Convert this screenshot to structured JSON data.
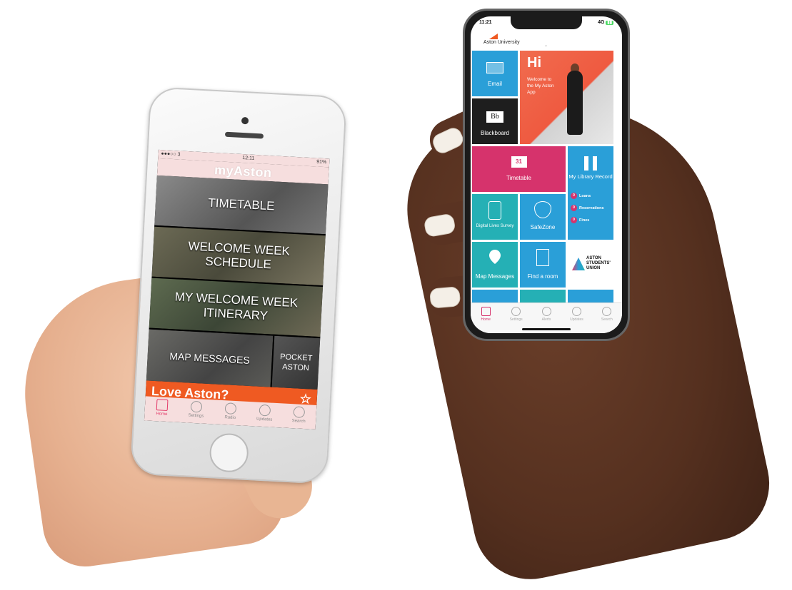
{
  "left_phone": {
    "status": {
      "carrier": "●●●○○ 3",
      "time": "12:11",
      "battery": "91%"
    },
    "header_title": "myAston",
    "tiles": {
      "timetable": "TIMETABLE",
      "welcome_week": "WELCOME WEEK SCHEDULE",
      "itinerary": "MY WELCOME WEEK ITINERARY",
      "map_messages": "MAP MESSAGES",
      "pocket_aston": "POCKET ASTON"
    },
    "banner": {
      "text": "Love Aston?",
      "icon": "star-icon"
    },
    "tabs": [
      "Home",
      "Settings",
      "Radio",
      "Updates",
      "Search"
    ]
  },
  "right_phone": {
    "status": {
      "time": "11:21",
      "network": "4G"
    },
    "header": {
      "logo_text": "Aston University",
      "chevron": "⌄"
    },
    "tiles": {
      "email": "Email",
      "blackboard": "Blackboard",
      "blackboard_badge": "Bb",
      "hi_title": "Hi",
      "hi_subtitle": "Welcome to the My Aston App",
      "timetable": "Timetable",
      "timetable_badge": "31",
      "library": "My Library Record",
      "library_items": [
        {
          "count": "0",
          "label": "Loans"
        },
        {
          "count": "0",
          "label": "Reservations"
        },
        {
          "count": "0",
          "label": "Fines"
        }
      ],
      "digital_lives": "Digital Lives Survey",
      "safezone": "SafeZone",
      "map_messages": "Map Messages",
      "find_room": "Find a room",
      "students_union": "ASTON STUDENTS' UNION"
    },
    "tabs": [
      "Home",
      "Settings",
      "Alerts",
      "Updates",
      "Search"
    ]
  },
  "colors": {
    "orange": "#ef5a22",
    "pink": "#d6336c",
    "blue": "#2a9fd8",
    "teal": "#25b0b5"
  }
}
